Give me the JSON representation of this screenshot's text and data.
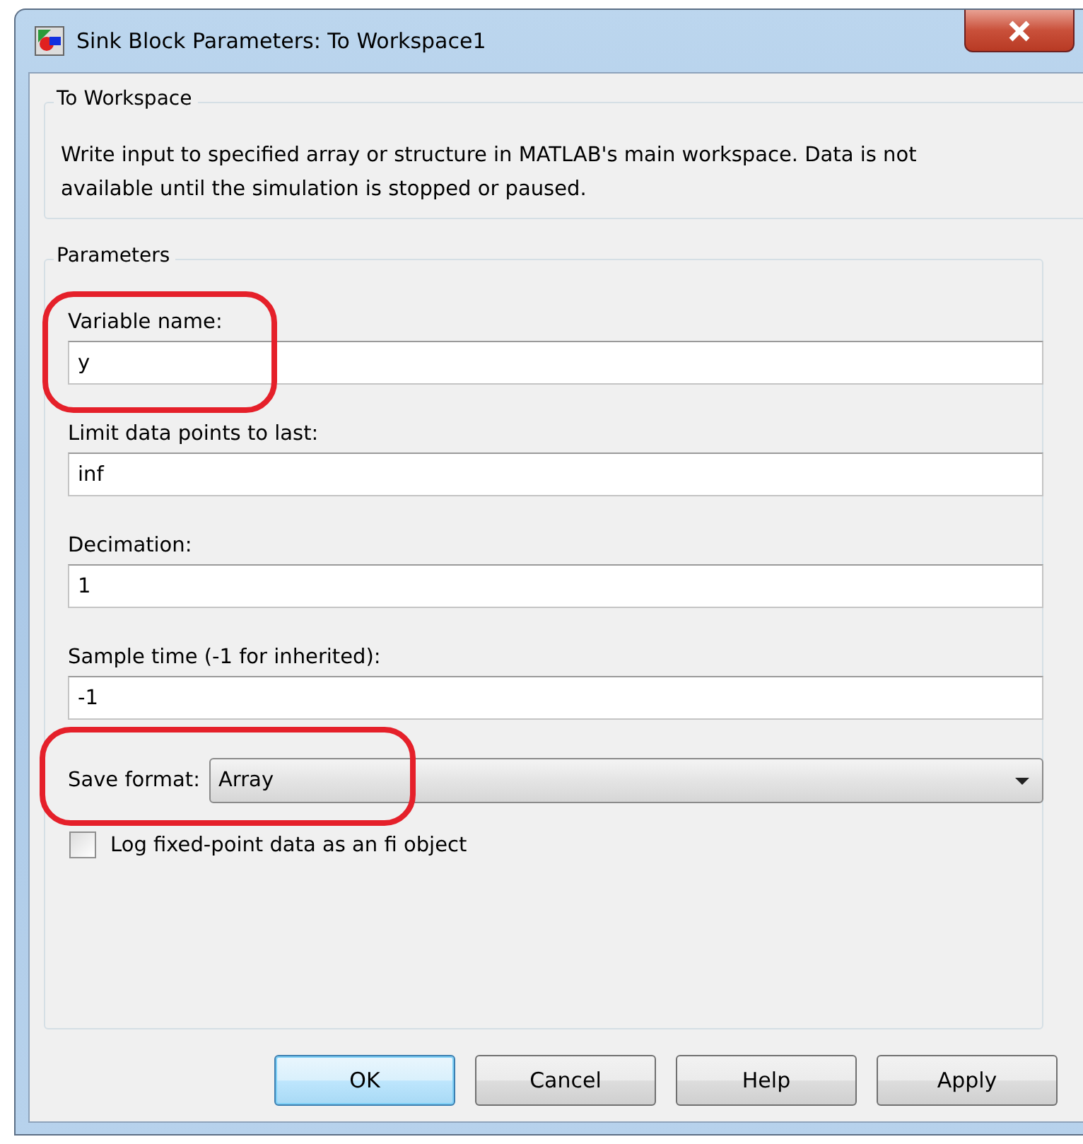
{
  "window": {
    "title": "Sink Block Parameters: To Workspace1"
  },
  "description_group": {
    "title": "To Workspace",
    "text": "Write input to specified array or structure in MATLAB's main workspace. Data is not available until the simulation is stopped or paused."
  },
  "parameters_group": {
    "title": "Parameters",
    "fields": [
      {
        "label": "Variable name:",
        "value": "y",
        "highlighted": true
      },
      {
        "label": "Limit data points to last:",
        "value": "inf",
        "highlighted": false
      },
      {
        "label": "Decimation:",
        "value": "1",
        "highlighted": false
      },
      {
        "label": "Sample time (-1 for inherited):",
        "value": "-1",
        "highlighted": false
      }
    ],
    "save_format": {
      "label": "Save format:",
      "value": "Array",
      "highlighted": true
    },
    "checkbox": {
      "label": "Log fixed-point data as an fi object",
      "checked": false
    }
  },
  "buttons": [
    {
      "label": "OK",
      "default": true
    },
    {
      "label": "Cancel",
      "default": false
    },
    {
      "label": "Help",
      "default": false
    },
    {
      "label": "Apply",
      "default": false
    }
  ]
}
